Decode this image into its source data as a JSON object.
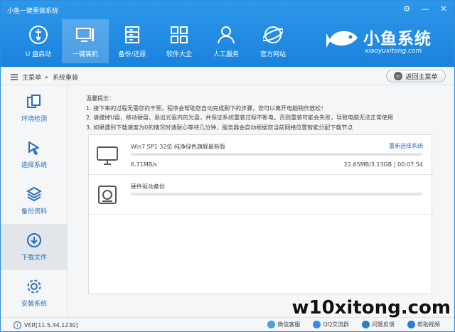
{
  "window": {
    "title": "小鱼一键重装系统",
    "controls": [
      "⚙",
      "—",
      "✕"
    ]
  },
  "nav": [
    {
      "label": "U 盘启动",
      "icon": "usb-icon",
      "active": false
    },
    {
      "label": "一键装机",
      "icon": "computer-icon",
      "active": true
    },
    {
      "label": "备份/还原",
      "icon": "backup-icon",
      "active": false
    },
    {
      "label": "软件大全",
      "icon": "apps-grid-icon",
      "active": false
    },
    {
      "label": "人工服务",
      "icon": "person-service-icon",
      "active": false
    },
    {
      "label": "官方网站",
      "icon": "globe-icon",
      "active": false
    }
  ],
  "logo": {
    "text": "小鱼系统",
    "sub": "xiaoyuxitong.com"
  },
  "breadcrumb": {
    "home": "主菜单",
    "sep": "▸",
    "current": "系统重装"
  },
  "back_button": {
    "label": "返回主菜单"
  },
  "sidebar": [
    {
      "label": "环境检测",
      "icon": "environment-check-icon",
      "active": false
    },
    {
      "label": "选择系统",
      "icon": "cursor-select-icon",
      "active": false
    },
    {
      "label": "备份资料",
      "icon": "layers-backup-icon",
      "active": false
    },
    {
      "label": "下载文件",
      "icon": "download-icon",
      "active": true
    },
    {
      "label": "安装系统",
      "icon": "settings-install-icon",
      "active": false
    }
  ],
  "tips": {
    "title": "温馨提示：",
    "lines": [
      "1. 接下来的过程无需您的干预，程序会帮助您自动完成剩下的步骤，您可以离开电脑稍作放松！",
      "2. 请拔掉U盘、移动硬盘，退出光驱内的光盘，并保证系统重装过程不断电。否则重装可能会失败，导致电脑无法正常使用",
      "3. 如果遇到下载速度为0的情况时请耐心等待几分钟，服务器会自动根据您当前网络位置智能分配下载节点"
    ]
  },
  "tasks": [
    {
      "name": "Win7 SP1 32位 纯净绿色旗舰最新版",
      "link": "重新选择系统",
      "progress": 0.0,
      "speed": "6.71MB/s",
      "size": "22.65MB/3.13GB | 00:07:54"
    },
    {
      "name": "硬件驱动备份",
      "progress": 0.0
    }
  ],
  "footer": {
    "version": "VER[11.5.44.1230]",
    "links": [
      {
        "label": "微信客服",
        "icon": "wechat-icon"
      },
      {
        "label": "QQ交流群",
        "icon": "qq-icon"
      },
      {
        "label": "问题反馈",
        "icon": "feedback-icon"
      },
      {
        "label": "帮助视频",
        "icon": "help-video-icon"
      }
    ]
  },
  "watermark": "w10xitong.com",
  "colors": {
    "header": "#1a82dc",
    "accent": "#2a6fb8",
    "progress": "#3d95e2"
  }
}
